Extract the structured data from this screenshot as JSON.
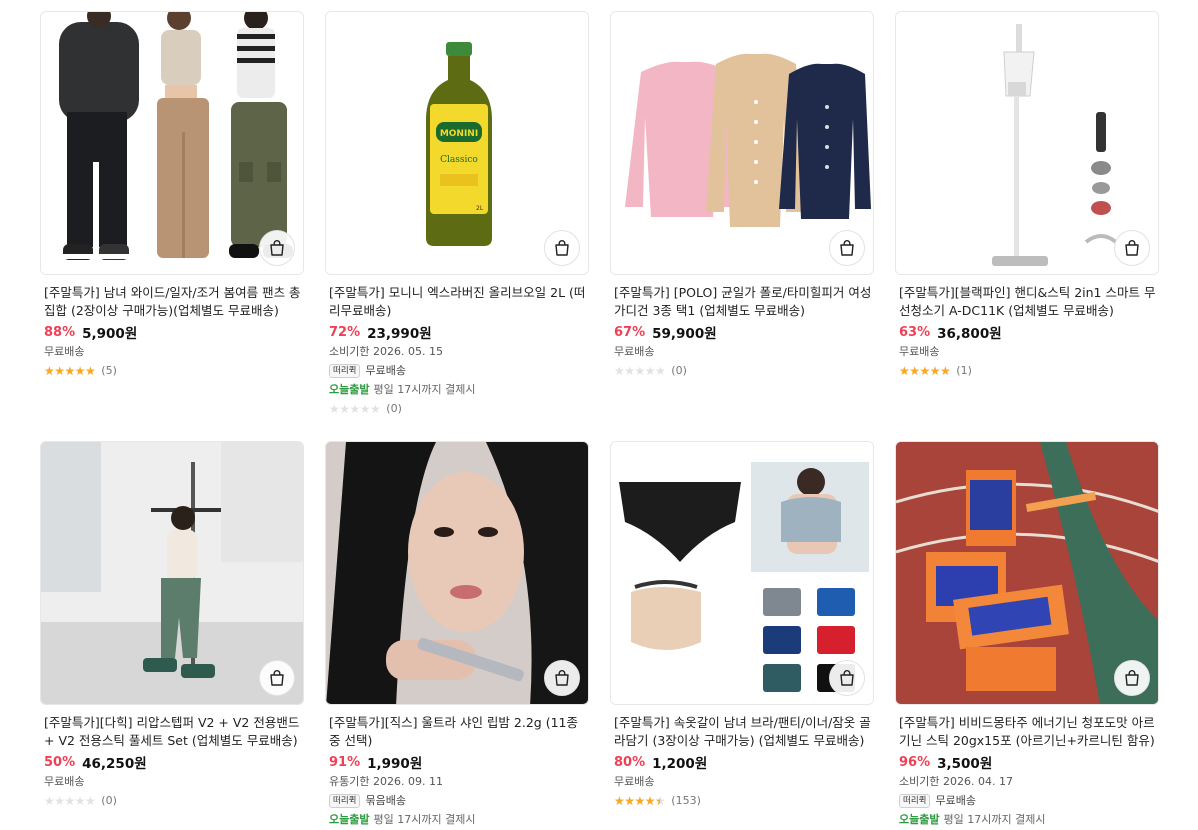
{
  "products": [
    {
      "title": "[주말특가] 남녀 와이드/일자/조거 봄여름 팬츠 총집합 (2장이상 구매가능)(업체별도 무료배송)",
      "discount": "88%",
      "price": "5,900원",
      "meta1": "무료배송",
      "meta2": "",
      "badge": "",
      "badge_text": "",
      "today_label": "",
      "today_text": "",
      "rating": 5,
      "reviews": "(5)"
    },
    {
      "title": "[주말특가] 모니니 엑스라버진 올리브오일 2L (떠리무료배송)",
      "discount": "72%",
      "price": "23,990원",
      "meta1": "소비기한 2026. 05. 15",
      "meta2": "",
      "badge": "떠리퀵",
      "badge_text": "무료배송",
      "today_label": "오늘출발",
      "today_text": "평일 17시까지 결제시",
      "rating": 0,
      "reviews": "(0)"
    },
    {
      "title": "[주말특가] [POLO] 균일가 폴로/타미힐피거 여성 가디건 3종 택1 (업체별도 무료배송)",
      "discount": "67%",
      "price": "59,900원",
      "meta1": "무료배송",
      "meta2": "",
      "badge": "",
      "badge_text": "",
      "today_label": "",
      "today_text": "",
      "rating": 0,
      "reviews": "(0)"
    },
    {
      "title": "[주말특가][블랙파인] 핸디&스틱 2in1 스마트 무선청소기 A-DC11K (업체별도 무료배송)",
      "discount": "63%",
      "price": "36,800원",
      "meta1": "무료배송",
      "meta2": "",
      "badge": "",
      "badge_text": "",
      "today_label": "",
      "today_text": "",
      "rating": 5,
      "reviews": "(1)"
    },
    {
      "title": "[주말특가][다힉] 리압스텝퍼 V2 + V2 전용밴드+ V2 전용스틱 풀세트 Set (업체별도 무료배송)",
      "discount": "50%",
      "price": "46,250원",
      "meta1": "무료배송",
      "meta2": "",
      "badge": "",
      "badge_text": "",
      "today_label": "",
      "today_text": "",
      "rating": 0,
      "reviews": "(0)"
    },
    {
      "title": "[주말특가][직스] 울트라 샤인 립밤 2.2g (11종 중 선택)",
      "discount": "91%",
      "price": "1,990원",
      "meta1": "유통기한 2026. 09. 11",
      "meta2": "",
      "badge": "떠리퀵",
      "badge_text": "묶음배송",
      "today_label": "오늘출발",
      "today_text": "평일 17시까지 결제시",
      "rating": null,
      "reviews": ""
    },
    {
      "title": "[주말특가] 속옷갈이 남녀 브라/팬티/이너/잠옷 골라담기 (3장이상 구매가능) (업체별도 무료배송)",
      "discount": "80%",
      "price": "1,200원",
      "meta1": "무료배송",
      "meta2": "",
      "badge": "",
      "badge_text": "",
      "today_label": "",
      "today_text": "",
      "rating": 4.5,
      "reviews": "(153)"
    },
    {
      "title": "[주말특가] 비비드몽타주 에너기닌 청포도맛 아르기닌 스틱 20gx15포 (아르기닌+카르니틴 함유)",
      "discount": "96%",
      "price": "3,500원",
      "meta1": "소비기한 2026. 04. 17",
      "meta2": "",
      "badge": "떠리퀵",
      "badge_text": "무료배송",
      "today_label": "오늘출발",
      "today_text": "평일 17시까지 결제시",
      "rating": null,
      "reviews": ""
    }
  ],
  "colors": {
    "discount": "#ef4056",
    "star": "#f9a825",
    "today": "#2e9b3f"
  },
  "icons": {
    "cart": "shopping-bag-icon",
    "star": "star-icon"
  }
}
